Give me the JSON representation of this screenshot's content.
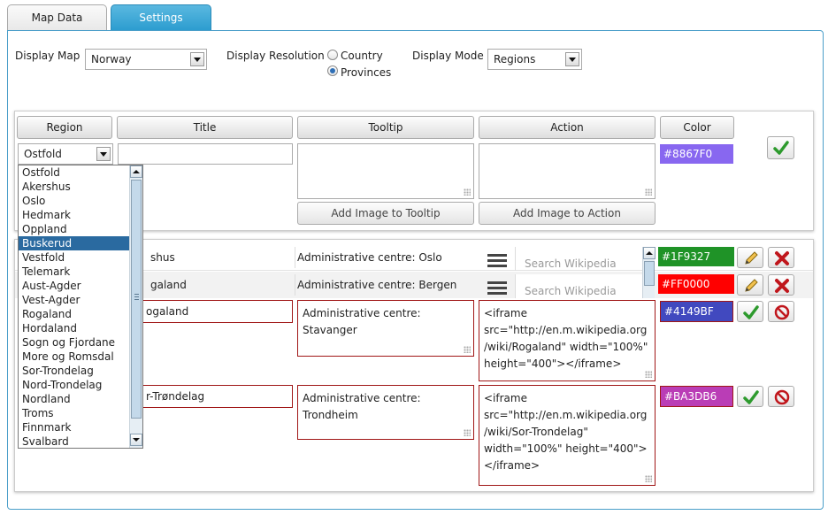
{
  "tabs": [
    {
      "label": "Map Data"
    },
    {
      "label": "Settings"
    }
  ],
  "display": {
    "map_label": "Display Map",
    "map_value": "Norway",
    "resolution_label": "Display Resolution",
    "resolution_options": [
      "Country",
      "Provinces"
    ],
    "resolution_selected": "Provinces",
    "mode_label": "Display Mode",
    "mode_value": "Regions"
  },
  "columns": {
    "region": "Region",
    "title": "Title",
    "tooltip": "Tooltip",
    "action": "Action",
    "color": "Color"
  },
  "new_row": {
    "region_value": "Ostfold",
    "title": "",
    "tooltip": "",
    "action": "",
    "color": "#8867F0",
    "add_image_tooltip": "Add Image to Tooltip",
    "add_image_action": "Add Image to Action"
  },
  "dropdown": {
    "selected": "Buskerud",
    "options": [
      "Ostfold",
      "Akershus",
      "Oslo",
      "Hedmark",
      "Oppland",
      "Buskerud",
      "Vestfold",
      "Telemark",
      "Aust-Agder",
      "Vest-Agder",
      "Rogaland",
      "Hordaland",
      "Sogn og Fjordane",
      "More og Romsdal",
      "Sor-Trondelag",
      "Nord-Trondelag",
      "Nordland",
      "Troms",
      "Finnmark",
      "Svalbard"
    ]
  },
  "rows": [
    {
      "title": "shus",
      "tooltip": "Administrative centre: Oslo",
      "action_placeholder": "Search Wikipedia",
      "color": "#1F9327"
    },
    {
      "title": "galand",
      "tooltip": "Administrative centre: Bergen",
      "action_placeholder": "Search Wikipedia",
      "color": "#FF0000"
    },
    {
      "title": "ogaland",
      "tooltip": "Administrative centre:\nStavanger",
      "action": "<iframe\nsrc=\"http://en.m.wikipedia.org\n/wiki/Rogaland\" width=\"100%\"\nheight=\"400\"></iframe>",
      "color": "#4149BF"
    },
    {
      "title": "r-Trøndelag",
      "tooltip": "Administrative centre:\nTrondheim",
      "action": "<iframe\nsrc=\"http://en.m.wikipedia.org\n/wiki/Sor-Trondelag\"\nwidth=\"100%\" height=\"400\">\n</iframe>",
      "color": "#BA3DB6"
    }
  ]
}
